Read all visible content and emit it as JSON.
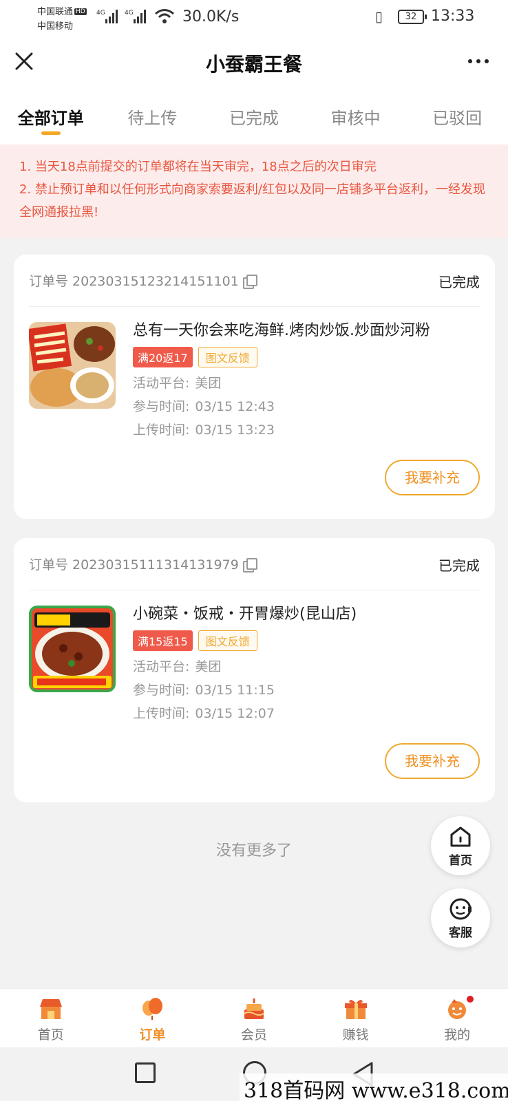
{
  "status_bar": {
    "carrier1": "中国联通",
    "carrier1_badge": "HD",
    "carrier2": "中国移动",
    "signal1_label": "4G",
    "signal2_label": "4G",
    "net_speed": "30.0K/s",
    "battery": "32",
    "time": "13:33"
  },
  "header": {
    "title": "小蚕霸王餐"
  },
  "tabs": [
    {
      "label": "全部订单",
      "active": true
    },
    {
      "label": "待上传",
      "active": false
    },
    {
      "label": "已完成",
      "active": false
    },
    {
      "label": "审核中",
      "active": false
    },
    {
      "label": "已驳回",
      "active": false
    }
  ],
  "notice": {
    "line1": "1. 当天18点前提交的订单都将在当天审完，18点之后的次日审完",
    "line2": "2. 禁止预订单和以任何形式向商家索要返利/红包以及同一店铺多平台返利，一经发现全网通报拉黑!"
  },
  "orders": [
    {
      "order_label": "订单号",
      "order_no": "20230315123214151101",
      "status": "已完成",
      "shop_name": "总有一天你会来吃海鲜.烤肉炒饭.炒面炒河粉",
      "promo_tag": "满20返17",
      "feedback_tag": "图文反馈",
      "platform_label": "活动平台:",
      "platform": "美团",
      "join_label": "参与时间:",
      "join_time": "03/15 12:43",
      "upload_label": "上传时间:",
      "upload_time": "03/15 13:23",
      "button": "我要补充"
    },
    {
      "order_label": "订单号",
      "order_no": "20230315111314131979",
      "status": "已完成",
      "shop_name": "小碗菜・饭戒・开胃爆炒(昆山店)",
      "promo_tag": "满15返15",
      "feedback_tag": "图文反馈",
      "platform_label": "活动平台:",
      "platform": "美团",
      "join_label": "参与时间:",
      "join_time": "03/15 11:15",
      "upload_label": "上传时间:",
      "upload_time": "03/15 12:07",
      "button": "我要补充"
    }
  ],
  "no_more": "没有更多了",
  "floating": {
    "home": "首页",
    "service": "客服"
  },
  "bottom_nav": [
    {
      "label": "首页",
      "icon": "shop-icon",
      "active": false
    },
    {
      "label": "订单",
      "icon": "balloon-icon",
      "active": true
    },
    {
      "label": "会员",
      "icon": "cake-icon",
      "active": false
    },
    {
      "label": "赚钱",
      "icon": "gift-icon",
      "active": false
    },
    {
      "label": "我的",
      "icon": "face-icon",
      "active": false
    }
  ],
  "watermark": "318首码网 www.e318.com",
  "colors": {
    "accent": "#f0a830",
    "notice_text": "#e8563f",
    "notice_bg": "#fdecec",
    "promo_red": "#f05a4a"
  }
}
